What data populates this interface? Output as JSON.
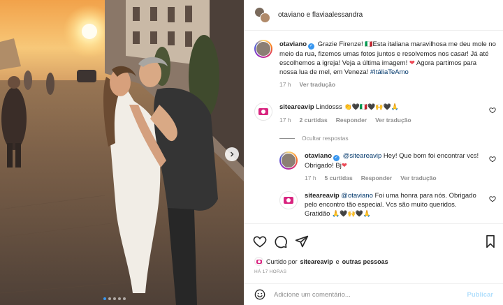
{
  "header": {
    "title": "otaviano e flaviaalessandra"
  },
  "caption": {
    "username": "otaviano",
    "text_1": "Grazie Firenze! ",
    "flag": "🇮🇹",
    "text_2": "Esta italiana maravilhosa me deu mole no meio da rua, fizemos umas fotos juntos e resolvemos nos casar! Já até escolhemos a igreja! Veja a última imagem! ",
    "heart": "❤",
    "text_3": " Agora partimos para nossa lua de mel, em Veneza! ",
    "hashtag": "#ItáliaTeAmo",
    "time": "17 h",
    "translate": "Ver tradução"
  },
  "comments": [
    {
      "username": "siteareavip",
      "text": "Lindosss ",
      "emojis": "👏🖤🇮🇹🖤🙌🖤🙏",
      "time": "17 h",
      "likes": "2 curtidas",
      "reply": "Responder",
      "translate": "Ver tradução"
    }
  ],
  "hide_replies": "Ocultar respostas",
  "replies": [
    {
      "username": "otaviano",
      "mention": "@siteareavip",
      "text": " Hey! Que bom foi encontrar vcs! Obrigado! Bj",
      "heart": "❤",
      "time": "17 h",
      "likes": "5 curtidas",
      "reply": "Responder",
      "translate": "Ver tradução"
    },
    {
      "username": "siteareavip",
      "mention": "@otaviano",
      "text": " Foi uma honra para nós. Obrigado pelo encontro tão especial. Vcs são muito queridos. Gratidão ",
      "emojis": "🙏🖤🙌🖤🙏"
    }
  ],
  "liked_by": {
    "prefix": "Curtido por ",
    "user": "siteareavip",
    "and": " e ",
    "others": "outras pessoas"
  },
  "time_ago": "HÁ 17 HORAS",
  "add_comment": {
    "placeholder": "Adicione um comentário...",
    "publish": "Publicar"
  },
  "colors": {
    "link": "#00376b",
    "verified": "#3897f0",
    "like_red": "#ed4956",
    "muted": "#8e8e8e"
  },
  "carousel": {
    "slides": 5,
    "active": 1
  }
}
